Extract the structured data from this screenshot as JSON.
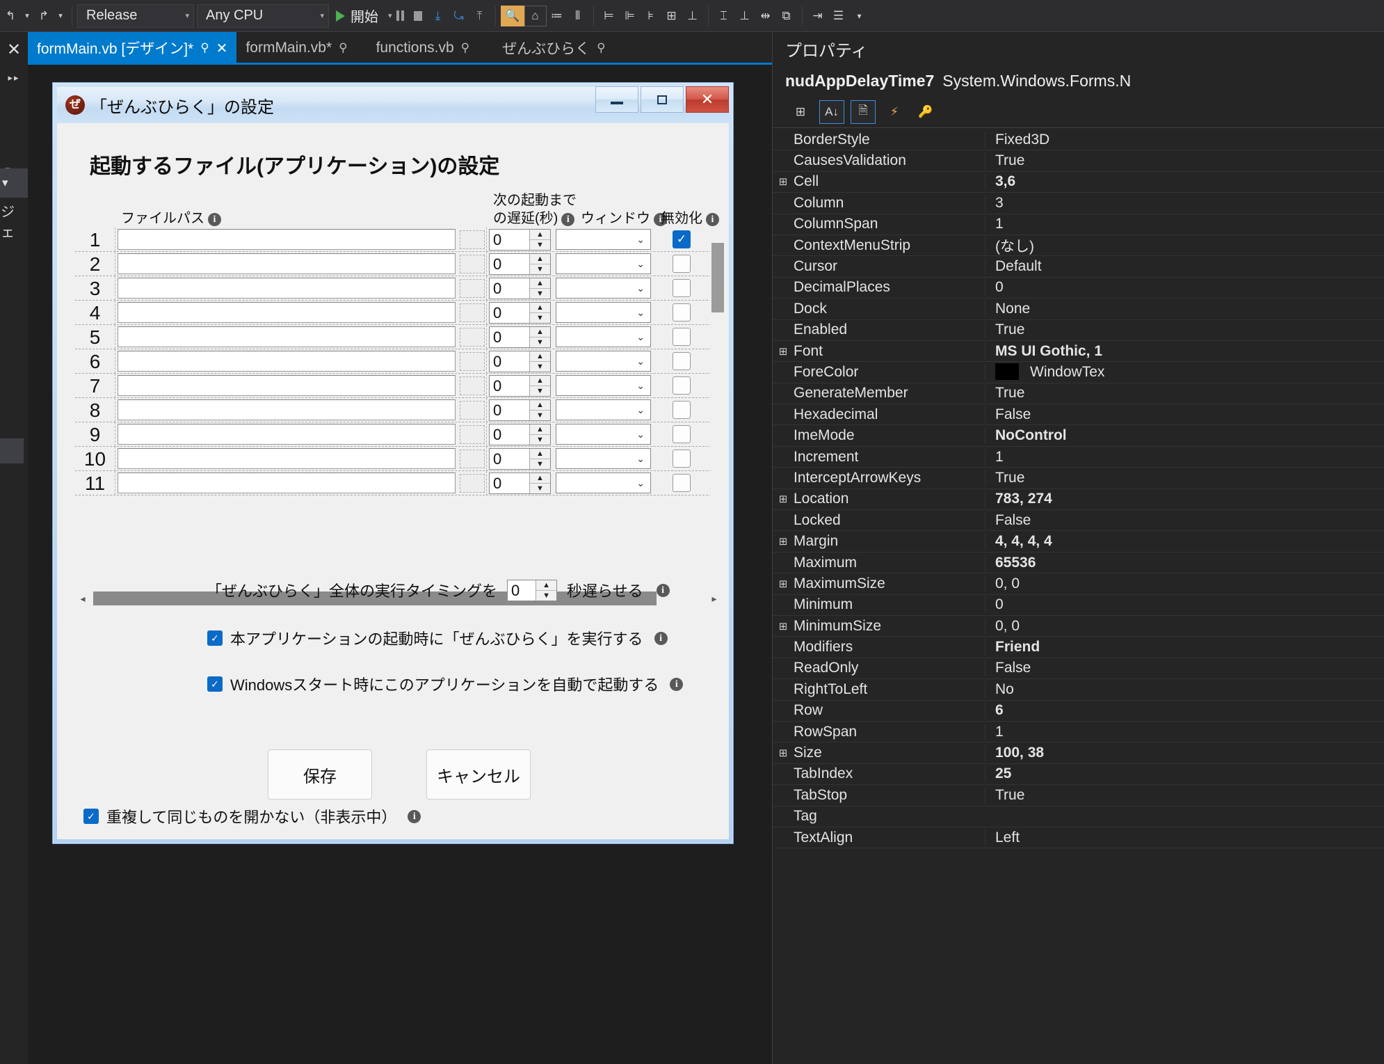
{
  "toolbar": {
    "config_value": "Release",
    "platform_value": "Any CPU",
    "run_label": "開始",
    "icons": [
      "undo-icon",
      "undo-dropdown-icon",
      "redo-icon",
      "redo-dropdown-icon",
      "start-icon",
      "pause-icon",
      "stop-icon",
      "step-into-icon",
      "step-over-icon",
      "step-out-icon",
      "find-icon",
      "home-icon",
      "align-icon",
      "tabulate-icon",
      "align-left-icon",
      "align-center-icon",
      "align-right-icon",
      "align-top-icon",
      "align-middle-icon",
      "align-bottom-icon",
      "size-width-icon",
      "size-height-icon",
      "spacing-icon",
      "order-icon",
      "center-horizontally-icon",
      "lock-icon"
    ]
  },
  "tabs": {
    "close_all_label": "X",
    "items": [
      {
        "label": "formMain.vb [デザイン]*",
        "pinned": true,
        "closable": true,
        "active": true
      },
      {
        "label": "formMain.vb*",
        "pinned": true,
        "closable": false,
        "active": false
      },
      {
        "label": "functions.vb",
        "pinned": true,
        "closable": false,
        "active": false
      },
      {
        "label": "ぜんぶひらく",
        "pinned": true,
        "closable": false,
        "active": false
      }
    ],
    "overflow_label": "▾",
    "settings_label": "⚙"
  },
  "left_rail": {
    "close_label": "✕",
    "expand_label": "▸▸",
    "dropdown_label": "▾",
    "partial_label": "ジェ",
    "zero_label": "ᗡ"
  },
  "dialog": {
    "title": "「ぜんぶひらく」の設定",
    "icon_glyph": "ぜ",
    "minimize_label": "最小化",
    "maximize_label": "最大化",
    "close_label": "✕",
    "heading": "起動するファイル(アプリケーション)の設定",
    "columns": {
      "filepath": "ファイルパス",
      "delay_line1": "次の起動まで",
      "delay_line2": "の遅延(秒)",
      "window": "ウィンドウ",
      "disable": "無効化"
    },
    "rows": [
      {
        "num": "1",
        "path": "",
        "delay": "0",
        "window": "",
        "disabled": true
      },
      {
        "num": "2",
        "path": "",
        "delay": "0",
        "window": "",
        "disabled": false
      },
      {
        "num": "3",
        "path": "",
        "delay": "0",
        "window": "",
        "disabled": false
      },
      {
        "num": "4",
        "path": "",
        "delay": "0",
        "window": "",
        "disabled": false
      },
      {
        "num": "5",
        "path": "",
        "delay": "0",
        "window": "",
        "disabled": false
      },
      {
        "num": "6",
        "path": "",
        "delay": "0",
        "window": "",
        "disabled": false
      },
      {
        "num": "7",
        "path": "",
        "delay": "0",
        "window": "",
        "disabled": false
      },
      {
        "num": "8",
        "path": "",
        "delay": "0",
        "window": "",
        "disabled": false
      },
      {
        "num": "9",
        "path": "",
        "delay": "0",
        "window": "",
        "disabled": false
      },
      {
        "num": "10",
        "path": "",
        "delay": "0",
        "window": "",
        "disabled": false
      },
      {
        "num": "11",
        "path": "",
        "delay": "0",
        "window": "",
        "disabled": false
      }
    ],
    "timing": {
      "prefix": "「ぜんぶひらく」全体の実行タイミングを",
      "value": "0",
      "suffix": "秒遅らせる"
    },
    "checkbox_startup": "本アプリケーションの起動時に「ぜんぶひらく」を実行する",
    "checkbox_windows_start": "Windowsスタート時にこのアプリケーションを自動で起動する",
    "checkbox_nodup": "重複して同じものを開かない（非表示中）",
    "save_label": "保存",
    "cancel_label": "キャンセル",
    "spin_up": "▲",
    "spin_down": "▼",
    "dropdown_glyph": "⌄",
    "check_glyph": "✓",
    "scroll_left": "◂",
    "scroll_right": "▸"
  },
  "properties": {
    "pane_title": "プロパティ",
    "object_name": "nudAppDelayTime7",
    "object_type": "System.Windows.Forms.N",
    "toolbar_icons": [
      "categorized-icon",
      "alphabetical-icon",
      "properties-page-icon",
      "events-icon",
      "property-pages-icon"
    ],
    "rows": [
      {
        "expand": false,
        "name": "BorderStyle",
        "value": "Fixed3D",
        "bold": false
      },
      {
        "expand": false,
        "name": "CausesValidation",
        "value": "True",
        "bold": false
      },
      {
        "expand": true,
        "name": "Cell",
        "value": "3,6",
        "bold": true
      },
      {
        "expand": false,
        "name": "Column",
        "value": "3",
        "bold": false
      },
      {
        "expand": false,
        "name": "ColumnSpan",
        "value": "1",
        "bold": false
      },
      {
        "expand": false,
        "name": "ContextMenuStrip",
        "value": "(なし)",
        "bold": false
      },
      {
        "expand": false,
        "name": "Cursor",
        "value": "Default",
        "bold": false
      },
      {
        "expand": false,
        "name": "DecimalPlaces",
        "value": "0",
        "bold": false
      },
      {
        "expand": false,
        "name": "Dock",
        "value": "None",
        "bold": false
      },
      {
        "expand": false,
        "name": "Enabled",
        "value": "True",
        "bold": false
      },
      {
        "expand": true,
        "name": "Font",
        "value": "MS UI Gothic, 1",
        "bold": true
      },
      {
        "expand": false,
        "name": "ForeColor",
        "value": "WindowTex",
        "bold": false,
        "swatch": "#000000"
      },
      {
        "expand": false,
        "name": "GenerateMember",
        "value": "True",
        "bold": false
      },
      {
        "expand": false,
        "name": "Hexadecimal",
        "value": "False",
        "bold": false
      },
      {
        "expand": false,
        "name": "ImeMode",
        "value": "NoControl",
        "bold": true
      },
      {
        "expand": false,
        "name": "Increment",
        "value": "1",
        "bold": false
      },
      {
        "expand": false,
        "name": "InterceptArrowKeys",
        "value": "True",
        "bold": false
      },
      {
        "expand": true,
        "name": "Location",
        "value": "783, 274",
        "bold": true
      },
      {
        "expand": false,
        "name": "Locked",
        "value": "False",
        "bold": false
      },
      {
        "expand": true,
        "name": "Margin",
        "value": "4, 4, 4, 4",
        "bold": true
      },
      {
        "expand": false,
        "name": "Maximum",
        "value": "65536",
        "bold": true
      },
      {
        "expand": true,
        "name": "MaximumSize",
        "value": "0, 0",
        "bold": false
      },
      {
        "expand": false,
        "name": "Minimum",
        "value": "0",
        "bold": false
      },
      {
        "expand": true,
        "name": "MinimumSize",
        "value": "0, 0",
        "bold": false
      },
      {
        "expand": false,
        "name": "Modifiers",
        "value": "Friend",
        "bold": true
      },
      {
        "expand": false,
        "name": "ReadOnly",
        "value": "False",
        "bold": false
      },
      {
        "expand": false,
        "name": "RightToLeft",
        "value": "No",
        "bold": false
      },
      {
        "expand": false,
        "name": "Row",
        "value": "6",
        "bold": true
      },
      {
        "expand": false,
        "name": "RowSpan",
        "value": "1",
        "bold": false
      },
      {
        "expand": true,
        "name": "Size",
        "value": "100, 38",
        "bold": true
      },
      {
        "expand": false,
        "name": "TabIndex",
        "value": "25",
        "bold": true
      },
      {
        "expand": false,
        "name": "TabStop",
        "value": "True",
        "bold": false
      },
      {
        "expand": false,
        "name": "Tag",
        "value": "",
        "bold": false
      },
      {
        "expand": false,
        "name": "TextAlign",
        "value": "Left",
        "bold": false
      }
    ]
  },
  "colors": {
    "accent": "#007acc",
    "chrome": "#252526",
    "toolbar": "#2d2d30",
    "check": "#0a6ac8",
    "close_red": "#c0392b"
  }
}
